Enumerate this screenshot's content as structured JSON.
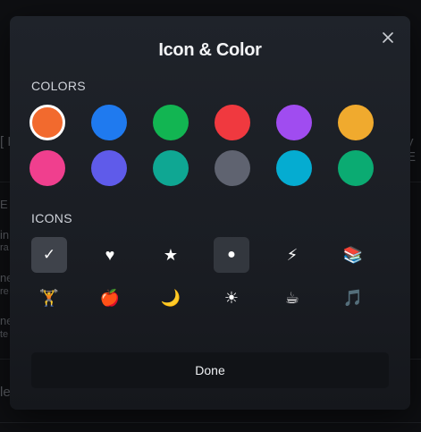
{
  "modal": {
    "title": "Icon & Color",
    "colors_label": "COLORS",
    "icons_label": "ICONS",
    "done_label": "Done",
    "close_icon": "close-icon"
  },
  "colors": [
    {
      "name": "orange",
      "hex": "#f26a2e",
      "selected": true
    },
    {
      "name": "blue",
      "hex": "#1f7aef",
      "selected": false
    },
    {
      "name": "green",
      "hex": "#12b552",
      "selected": false
    },
    {
      "name": "red",
      "hex": "#f0393f",
      "selected": false
    },
    {
      "name": "purple",
      "hex": "#a04cf0",
      "selected": false
    },
    {
      "name": "amber",
      "hex": "#f0aa2e",
      "selected": false
    },
    {
      "name": "pink",
      "hex": "#f03f8e",
      "selected": false
    },
    {
      "name": "indigo",
      "hex": "#5f5bea",
      "selected": false
    },
    {
      "name": "teal",
      "hex": "#0fa793",
      "selected": false
    },
    {
      "name": "gray",
      "hex": "#5f6370",
      "selected": false
    },
    {
      "name": "cyan",
      "hex": "#05acd1",
      "selected": false
    },
    {
      "name": "emerald",
      "hex": "#0bab72",
      "selected": false
    }
  ],
  "icons": [
    {
      "name": "checkmark-icon",
      "glyph": "✓",
      "state": "selected"
    },
    {
      "name": "heart-icon",
      "glyph": "♥",
      "state": ""
    },
    {
      "name": "star-icon",
      "glyph": "★",
      "state": ""
    },
    {
      "name": "circle-icon",
      "glyph": "●",
      "state": "hl"
    },
    {
      "name": "lightning-icon",
      "glyph": "⚡",
      "state": ""
    },
    {
      "name": "books-icon",
      "glyph": "📚",
      "state": ""
    },
    {
      "name": "weightlifter-icon",
      "glyph": "🏋",
      "state": ""
    },
    {
      "name": "apple-icon",
      "glyph": "🍎",
      "state": ""
    },
    {
      "name": "moon-icon",
      "glyph": "🌙",
      "state": ""
    },
    {
      "name": "sun-icon",
      "glyph": "☀",
      "state": ""
    },
    {
      "name": "coffee-icon",
      "glyph": "☕",
      "state": ""
    },
    {
      "name": "music-note-icon",
      "glyph": "🎵",
      "state": ""
    }
  ],
  "background_fragments": [
    {
      "text": "E"
    },
    {
      "text": "in"
    },
    {
      "text": "ra"
    },
    {
      "text": "ne"
    },
    {
      "text": "re"
    },
    {
      "text": "ne"
    },
    {
      "text": "te"
    },
    {
      "text": "le"
    },
    {
      "text": "[ D"
    },
    {
      "text": "y E"
    }
  ]
}
